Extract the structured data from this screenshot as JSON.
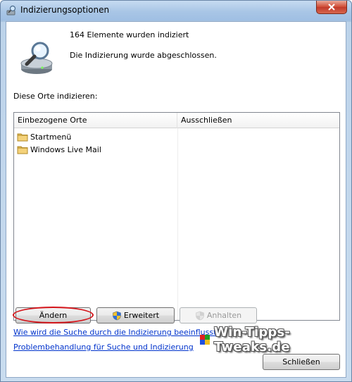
{
  "window": {
    "title": "Indizierungsoptionen"
  },
  "status": {
    "items_indexed": "164 Elemente wurden indiziert",
    "state": "Die Indizierung wurde abgeschlossen."
  },
  "locations": {
    "label": "Diese Orte indizieren:",
    "columns": [
      "Einbezogene Orte",
      "Ausschließen"
    ],
    "rows": [
      {
        "name": "Startmenü",
        "exclude": ""
      },
      {
        "name": "Windows Live Mail",
        "exclude": ""
      }
    ]
  },
  "buttons": {
    "change": "Ändern",
    "advanced": "Erweitert",
    "pause": "Anhalten",
    "close": "Schließen"
  },
  "links": {
    "search_influence": "Wie wird die Suche durch die Indizierung beeinflusst?",
    "troubleshoot": "Problembehandlung für Suche und Indizierung"
  },
  "watermark": {
    "text": "Win-Tipps-Tweaks.de"
  },
  "icons": {
    "title": "indexing-options-icon",
    "header": "magnifier-drive-icon",
    "folder": "folder-icon",
    "shield": "uac-shield-icon",
    "close": "close-icon"
  },
  "colors": {
    "annotation_red": "#d4141a",
    "link_blue": "#0033cc"
  }
}
